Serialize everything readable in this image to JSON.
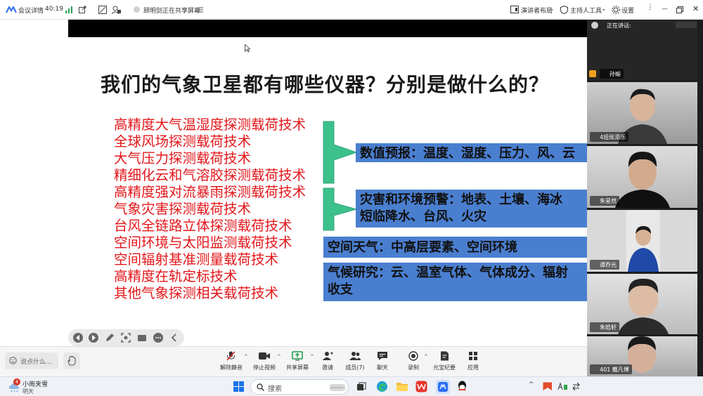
{
  "titlebar": {
    "meeting_details": "会议详情",
    "timer": "40:19",
    "sharing_status": "顾明剑正在共享屏幕",
    "presenter_layout": "演讲者布局",
    "host_tools": "主持人工具",
    "settings": "设置"
  },
  "slide": {
    "title": "我们的气象卫星都有哪些仪器？分别是做什么的？",
    "technologies": [
      "高精度大气温湿度探测载荷技术",
      "全球风场探测载荷技术",
      "大气压力探测载荷技术",
      "精细化云和气溶胶探测载荷技术",
      "高精度强对流暴雨探测载荷技术",
      "气象灾害探测载荷技术",
      "台风全链路立体探测载荷技术",
      "空间环境与太阳监测载荷技术",
      "空间辐射基准测量载荷技术",
      "高精度在轨定标技术",
      "其他气象探测相关载荷技术"
    ],
    "uses": {
      "forecast": "数值预报：温度、湿度、压力、风、云",
      "disaster_line1": "灾害和环境预警：地表、土壤、海冰",
      "disaster_line2": "短临降水、台风、火灾",
      "space_weather": "空间天气：中高层要素、空间环境",
      "climate_line1": "气候研究：云、温室气体、气体成分、辐射",
      "climate_line2": "收支"
    },
    "colors": {
      "list_text": "#e3171b",
      "box_fill": "#4a7fd0",
      "bracket_fill": "#3cc08c"
    }
  },
  "meeting_bar": {
    "chat_placeholder": "说点什么...",
    "buttons": [
      {
        "label": "解除静音",
        "icon": "mic-muted-icon"
      },
      {
        "label": "停止视频",
        "icon": "camera-icon"
      },
      {
        "label": "共享屏幕",
        "icon": "share-screen-icon"
      },
      {
        "label": "邀请",
        "icon": "invite-icon"
      },
      {
        "label": "成员(7)",
        "icon": "members-icon"
      },
      {
        "label": "聊天",
        "icon": "chat-icon"
      },
      {
        "label": "录制",
        "icon": "record-icon"
      },
      {
        "label": "元宝纪要",
        "icon": "notes-icon"
      },
      {
        "label": "应用",
        "icon": "apps-icon"
      }
    ]
  },
  "sidebar": {
    "speaking_label": "正在讲话:",
    "participants": [
      {
        "name": "孙瑜",
        "video": false
      },
      {
        "name": "4班侯添乐",
        "video": true
      },
      {
        "name": "朱星然",
        "video": true
      },
      {
        "name": "谭乔元",
        "video": true
      },
      {
        "name": "朱皓轩",
        "video": true
      },
      {
        "name": "401 戴凡博",
        "video": true
      }
    ]
  },
  "taskbar": {
    "weather_title": "小雨夹雪",
    "weather_sub": "明天",
    "weather_badge": "4",
    "search_placeholder": "搜索"
  }
}
